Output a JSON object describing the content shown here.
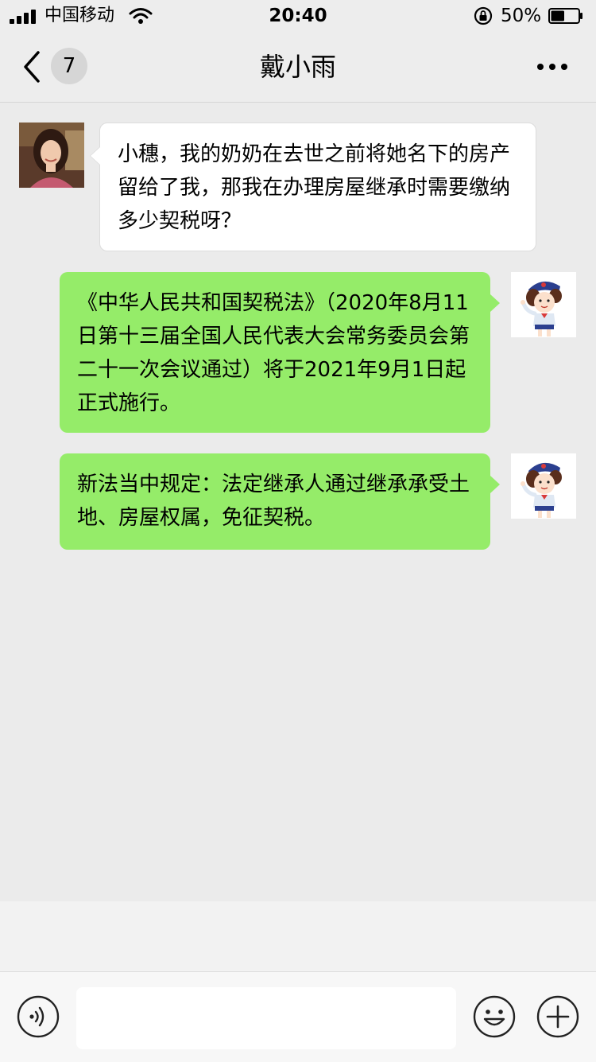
{
  "status_bar": {
    "carrier": "中国移动",
    "time": "20:40",
    "battery_percent": "50%",
    "battery_level": 0.5,
    "icons": [
      "signal-icon",
      "wifi-icon",
      "rotation-lock-icon",
      "battery-icon"
    ]
  },
  "nav": {
    "unread_count": "7",
    "title": "戴小雨",
    "icons": [
      "back-arrow-icon",
      "more-icon"
    ]
  },
  "messages": [
    {
      "direction": "incoming",
      "text": "小穗，我的奶奶在去世之前将她名下的房产留给了我，那我在办理房屋继承时需要缴纳多少契税呀？"
    },
    {
      "direction": "outgoing",
      "text": "《中华人民共和国契税法》（2020年8月11日第十三届全国人民代表大会常务委员会第二十一次会议通过）将于2021年9月1日起正式施行。"
    },
    {
      "direction": "outgoing",
      "text": "新法当中规定：法定继承人通过继承承受土地、房屋权属，免征契税。"
    }
  ],
  "input_bar": {
    "message_value": "",
    "icons": [
      "voice-icon",
      "emoji-icon",
      "plus-icon"
    ]
  },
  "colors": {
    "background": "#ebebeb",
    "bar_background": "#ededed",
    "outgoing_bubble": "#95ec69",
    "incoming_bubble": "#ffffff",
    "input_bar": "#f7f7f7"
  }
}
